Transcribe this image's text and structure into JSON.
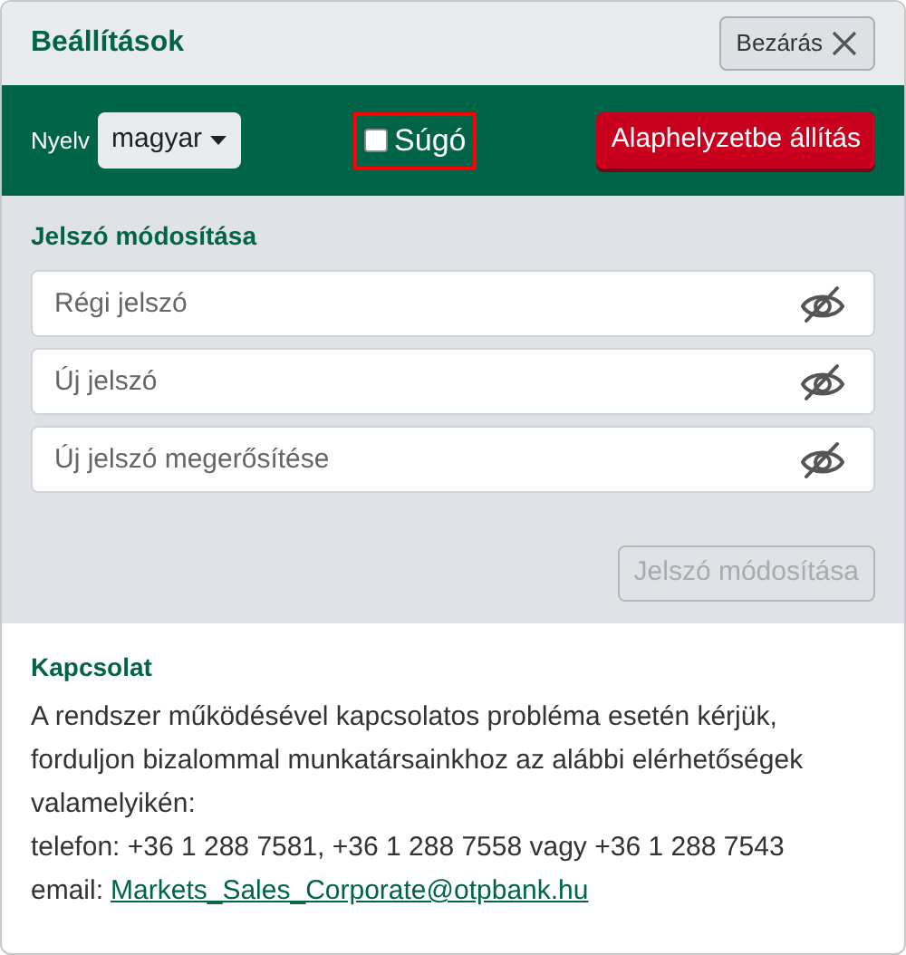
{
  "window": {
    "title": "Beállítások",
    "close_button": "Bezárás"
  },
  "toolbar": {
    "language_label": "Nyelv",
    "language_value": "magyar",
    "help": {
      "label": "Súgó",
      "checked": false,
      "highlighted": true
    },
    "reset_button": "Alaphelyzetbe állítás"
  },
  "password_section": {
    "title": "Jelszó módosítása",
    "fields": [
      {
        "placeholder": "Régi jelszó"
      },
      {
        "placeholder": "Új jelszó"
      },
      {
        "placeholder": "Új jelszó megerősítése"
      }
    ],
    "submit": {
      "label": "Jelszó módosítása",
      "disabled": true
    }
  },
  "contact": {
    "title": "Kapcsolat",
    "paragraph": "A rendszer működésével kapcsolatos probléma esetén kérjük, forduljon bizalommal munkatársainkhoz az alábbi elérhetőségek valamelyikén:",
    "phone": "telefon: +36 1 288 7581, +36 1 288 7558 vagy +36 1 288 7543",
    "email_label": "email:",
    "email": "Markets_Sales_Corporate@otpbank.hu"
  }
}
